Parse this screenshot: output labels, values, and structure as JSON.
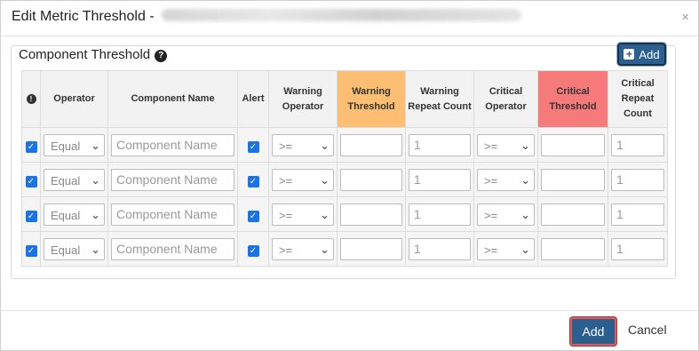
{
  "modal": {
    "title": "Edit Metric Threshold -",
    "close": "×"
  },
  "panel": {
    "title": "Component Threshold",
    "help": "?",
    "add_button": "Add"
  },
  "table": {
    "headers": {
      "info": "!",
      "operator": "Operator",
      "component_name": "Component Name",
      "alert": "Alert",
      "warning_operator": "Warning Operator",
      "warning_threshold": "Warning Threshold",
      "warning_repeat_count": "Warning Repeat Count",
      "critical_operator": "Critical Operator",
      "critical_threshold": "Critical Threshold",
      "critical_repeat_count": "Critical Repeat Count"
    },
    "rows": [
      {
        "checked": "✓",
        "operator": "Equal",
        "component_name_placeholder": "Component Name",
        "alert": "✓",
        "warning_operator": ">=",
        "warning_threshold": "",
        "warning_repeat_count": "1",
        "critical_operator": ">=",
        "critical_threshold": "",
        "critical_repeat_count": "1"
      },
      {
        "checked": "✓",
        "operator": "Equal",
        "component_name_placeholder": "Component Name",
        "alert": "✓",
        "warning_operator": ">=",
        "warning_threshold": "",
        "warning_repeat_count": "1",
        "critical_operator": ">=",
        "critical_threshold": "",
        "critical_repeat_count": "1"
      },
      {
        "checked": "✓",
        "operator": "Equal",
        "component_name_placeholder": "Component Name",
        "alert": "✓",
        "warning_operator": ">=",
        "warning_threshold": "",
        "warning_repeat_count": "1",
        "critical_operator": ">=",
        "critical_threshold": "",
        "critical_repeat_count": "1"
      },
      {
        "checked": "✓",
        "operator": "Equal",
        "component_name_placeholder": "Component Name",
        "alert": "✓",
        "warning_operator": ">=",
        "warning_threshold": "",
        "warning_repeat_count": "1",
        "critical_operator": ">=",
        "critical_threshold": "",
        "critical_repeat_count": "1"
      }
    ]
  },
  "footer": {
    "add_button": "Add",
    "cancel_button": "Cancel"
  },
  "icons": {
    "chevron": "chevron-down-icon",
    "help": "question-circle-icon",
    "info": "exclamation-circle-icon",
    "add": "plus-square-icon",
    "close": "close-icon",
    "check": "checkbox-checked-icon"
  },
  "colors": {
    "primary": "#2b5f8f",
    "warning_header": "#fcbe72",
    "critical_header": "#f77a7a",
    "checkbox": "#1a73e8"
  }
}
